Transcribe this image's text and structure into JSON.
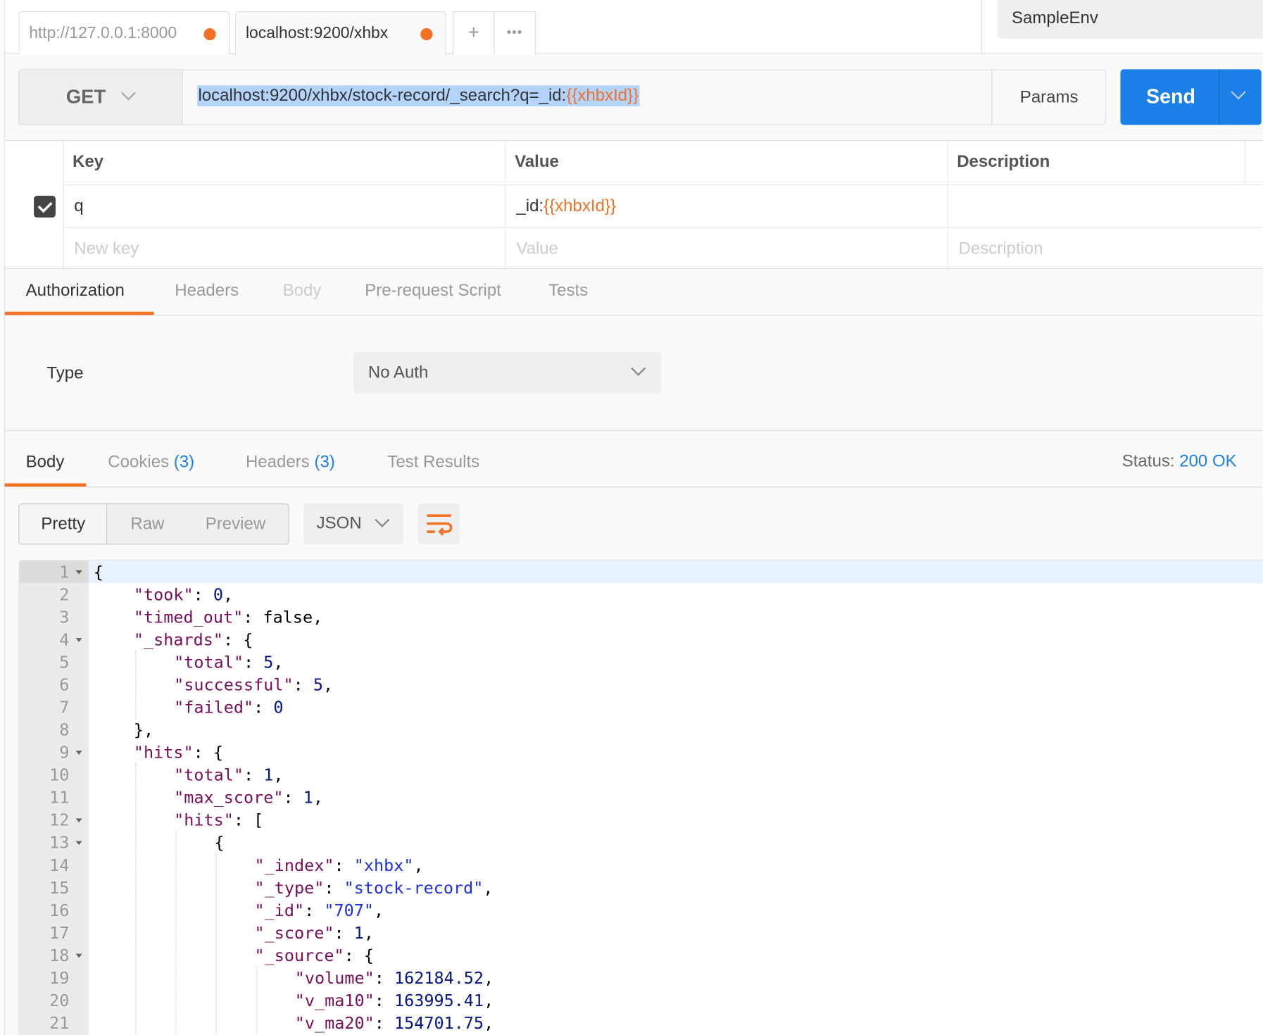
{
  "tabs": [
    {
      "label": "http://127.0.0.1:8000",
      "unsaved": true
    },
    {
      "label": "localhost:9200/xhbx",
      "unsaved": true,
      "active": true
    }
  ],
  "tab_actions": {
    "new_tab": "+",
    "more": "•••"
  },
  "environment": "SampleEnv",
  "request": {
    "method": "GET",
    "url_prefix": "localhost:9200/xhbx/stock-record/_search?q=_id:",
    "url_variable": "{{xhbxId}}",
    "params_label": "Params",
    "send_label": "Send"
  },
  "params_table": {
    "headers": [
      "Key",
      "Value",
      "Description"
    ],
    "rows": [
      {
        "checked": true,
        "key": "q",
        "value_prefix": "_id:",
        "value_variable": "{{xhbxId}}",
        "description": ""
      }
    ],
    "placeholders": {
      "key": "New key",
      "value": "Value",
      "description": "Description"
    }
  },
  "request_tabs": [
    "Authorization",
    "Headers",
    "Body",
    "Pre-request Script",
    "Tests"
  ],
  "active_request_tab": "Authorization",
  "auth": {
    "type_label": "Type",
    "type_value": "No Auth"
  },
  "response_tabs": {
    "body": "Body",
    "cookies": "Cookies",
    "cookies_count": "(3)",
    "headers": "Headers",
    "headers_count": "(3)",
    "tests": "Test Results"
  },
  "status": {
    "label": "Status:",
    "value": "200 OK"
  },
  "view_modes": [
    "Pretty",
    "Raw",
    "Preview"
  ],
  "active_view_mode": "Pretty",
  "format": "JSON",
  "colors": {
    "accent": "#f47023",
    "send": "#1a7fe6",
    "key": "#7a0e5a",
    "number": "#00148c",
    "string": "#1c2fe6"
  },
  "code_lines": [
    {
      "n": "1",
      "fold": true,
      "indent": 0,
      "t": [
        [
          "b",
          "{"
        ]
      ]
    },
    {
      "n": "2",
      "indent": 1,
      "t": [
        [
          "k",
          "\"took\""
        ],
        [
          "b",
          ": "
        ],
        [
          "n",
          "0"
        ],
        [
          "b",
          ","
        ]
      ]
    },
    {
      "n": "3",
      "indent": 1,
      "t": [
        [
          "k",
          "\"timed_out\""
        ],
        [
          "b",
          ": false,"
        ]
      ]
    },
    {
      "n": "4",
      "fold": true,
      "indent": 1,
      "t": [
        [
          "k",
          "\"_shards\""
        ],
        [
          "b",
          ": {"
        ]
      ]
    },
    {
      "n": "5",
      "indent": 2,
      "t": [
        [
          "k",
          "\"total\""
        ],
        [
          "b",
          ": "
        ],
        [
          "n",
          "5"
        ],
        [
          "b",
          ","
        ]
      ]
    },
    {
      "n": "6",
      "indent": 2,
      "t": [
        [
          "k",
          "\"successful\""
        ],
        [
          "b",
          ": "
        ],
        [
          "n",
          "5"
        ],
        [
          "b",
          ","
        ]
      ]
    },
    {
      "n": "7",
      "indent": 2,
      "t": [
        [
          "k",
          "\"failed\""
        ],
        [
          "b",
          ": "
        ],
        [
          "n",
          "0"
        ]
      ]
    },
    {
      "n": "8",
      "indent": 1,
      "t": [
        [
          "b",
          "},"
        ]
      ]
    },
    {
      "n": "9",
      "fold": true,
      "indent": 1,
      "t": [
        [
          "k",
          "\"hits\""
        ],
        [
          "b",
          ": {"
        ]
      ]
    },
    {
      "n": "10",
      "indent": 2,
      "t": [
        [
          "k",
          "\"total\""
        ],
        [
          "b",
          ": "
        ],
        [
          "n",
          "1"
        ],
        [
          "b",
          ","
        ]
      ]
    },
    {
      "n": "11",
      "indent": 2,
      "t": [
        [
          "k",
          "\"max_score\""
        ],
        [
          "b",
          ": "
        ],
        [
          "n",
          "1"
        ],
        [
          "b",
          ","
        ]
      ]
    },
    {
      "n": "12",
      "fold": true,
      "indent": 2,
      "t": [
        [
          "k",
          "\"hits\""
        ],
        [
          "b",
          ": ["
        ]
      ]
    },
    {
      "n": "13",
      "fold": true,
      "indent": 3,
      "t": [
        [
          "b",
          "{"
        ]
      ]
    },
    {
      "n": "14",
      "indent": 4,
      "t": [
        [
          "k",
          "\"_index\""
        ],
        [
          "b",
          ": "
        ],
        [
          "s",
          "\"xhbx\""
        ],
        [
          "b",
          ","
        ]
      ]
    },
    {
      "n": "15",
      "indent": 4,
      "t": [
        [
          "k",
          "\"_type\""
        ],
        [
          "b",
          ": "
        ],
        [
          "s",
          "\"stock-record\""
        ],
        [
          "b",
          ","
        ]
      ]
    },
    {
      "n": "16",
      "indent": 4,
      "t": [
        [
          "k",
          "\"_id\""
        ],
        [
          "b",
          ": "
        ],
        [
          "s",
          "\"707\""
        ],
        [
          "b",
          ","
        ]
      ]
    },
    {
      "n": "17",
      "indent": 4,
      "t": [
        [
          "k",
          "\"_score\""
        ],
        [
          "b",
          ": "
        ],
        [
          "n",
          "1"
        ],
        [
          "b",
          ","
        ]
      ]
    },
    {
      "n": "18",
      "fold": true,
      "indent": 4,
      "t": [
        [
          "k",
          "\"_source\""
        ],
        [
          "b",
          ": {"
        ]
      ]
    },
    {
      "n": "19",
      "indent": 5,
      "t": [
        [
          "k",
          "\"volume\""
        ],
        [
          "b",
          ": "
        ],
        [
          "n",
          "162184.52"
        ],
        [
          "b",
          ","
        ]
      ]
    },
    {
      "n": "20",
      "indent": 5,
      "t": [
        [
          "k",
          "\"v_ma10\""
        ],
        [
          "b",
          ": "
        ],
        [
          "n",
          "163995.41"
        ],
        [
          "b",
          ","
        ]
      ]
    },
    {
      "n": "21",
      "indent": 5,
      "t": [
        [
          "k",
          "\"v_ma20\""
        ],
        [
          "b",
          ": "
        ],
        [
          "n",
          "154701.75"
        ],
        [
          "b",
          ","
        ]
      ]
    }
  ]
}
